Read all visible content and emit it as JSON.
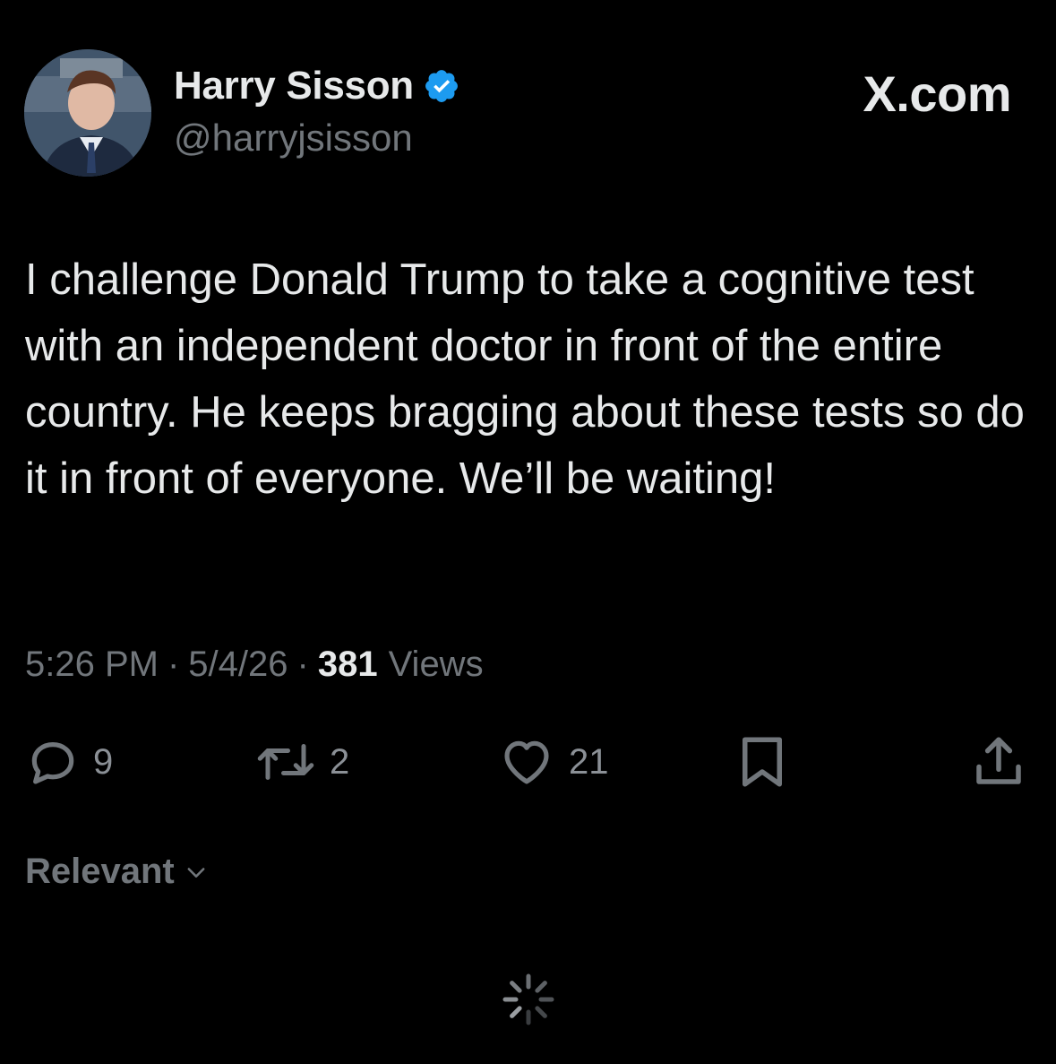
{
  "author": {
    "display_name": "Harry Sisson",
    "handle": "@harryjsisson",
    "verified": true,
    "verified_color": "#1d9bf0"
  },
  "site_mark": "X.com",
  "tweet": {
    "text": "I challenge Donald Trump to take a cognitive test with an independent doctor in front of the entire country. He keeps bragging about these tests so do it in front of everyone. We’ll be waiting!",
    "time": "5:26 PM",
    "date": "5/4/26",
    "separator": "·",
    "views_count": "381",
    "views_label": "Views"
  },
  "actions": {
    "replies": "9",
    "reposts": "2",
    "likes": "21"
  },
  "replies_sort": {
    "label": "Relevant"
  },
  "icons": {
    "reply": "reply-icon",
    "repost": "repost-icon",
    "like": "heart-icon",
    "bookmark": "bookmark-icon",
    "share": "share-icon",
    "loading": "loading-spinner-icon"
  },
  "colors": {
    "background": "#000000",
    "primary_text": "#e7e9ea",
    "secondary_text": "#71767b"
  }
}
